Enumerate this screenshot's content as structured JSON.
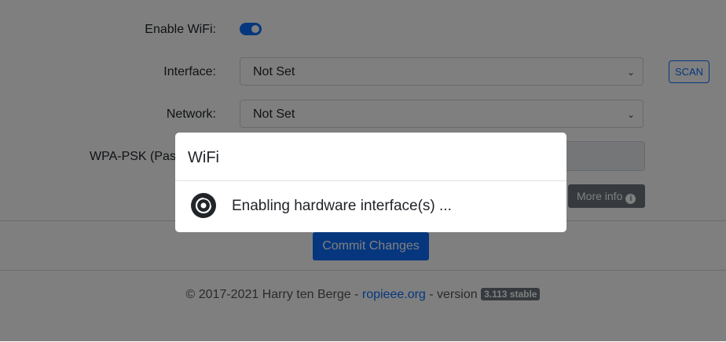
{
  "form": {
    "enable_wifi_label": "Enable WiFi:",
    "enable_wifi_on": true,
    "interface_label": "Interface:",
    "interface_value": "Not Set",
    "scan_label": "SCAN",
    "network_label": "Network:",
    "network_value": "Not Set",
    "psk_label": "WPA-PSK (Passp",
    "more_info_label": "More info",
    "commit_label": "Commit Changes"
  },
  "footer": {
    "prefix": "© 2017-2021 Harry ten Berge - ",
    "link": "ropieee.org",
    "middle": " - version ",
    "version_badge": "3.113 stable"
  },
  "modal": {
    "title": "WiFi",
    "icon": "disc-icon",
    "message": "Enabling hardware interface(s) ..."
  },
  "colors": {
    "accent": "#0d6efd",
    "badge": "#6c757d"
  }
}
